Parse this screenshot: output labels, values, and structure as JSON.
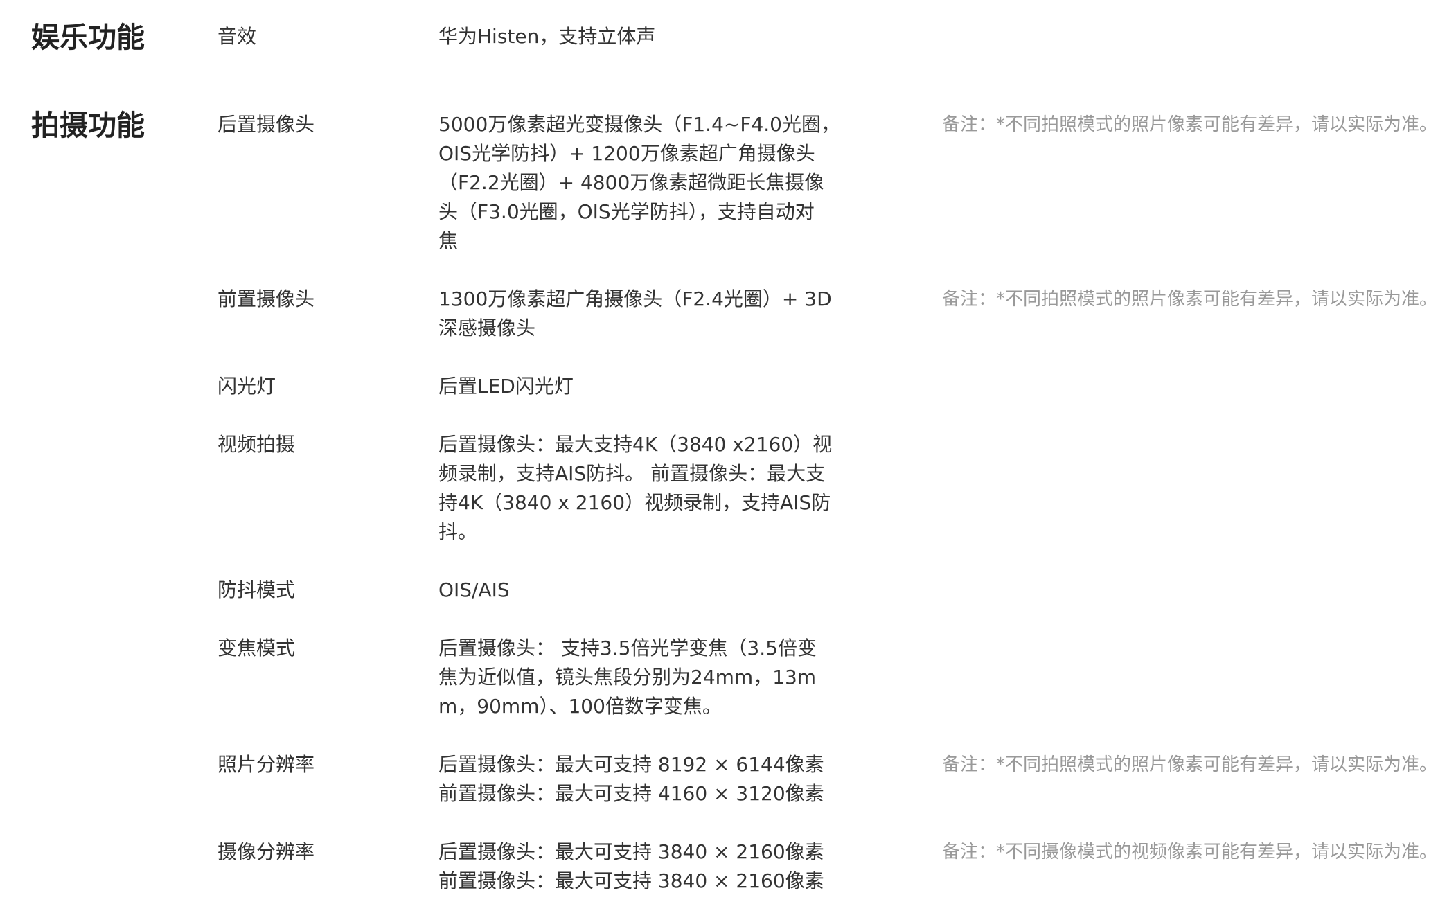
{
  "sections": [
    {
      "title": "娱乐功能",
      "rows": [
        {
          "label": "音效",
          "value_lines": [
            "华为Histen，支持立体声"
          ],
          "note": ""
        }
      ]
    },
    {
      "title": "拍摄功能",
      "rows": [
        {
          "label": "后置摄像头",
          "value_lines": [
            "5000万像素超光变摄像头（F1.4~F4.0光圈，",
            "OIS光学防抖）+ 1200万像素超广角摄像头",
            "（F2.2光圈）+ 4800万像素超微距长焦摄像",
            "头（F3.0光圈，OIS光学防抖），支持自动对",
            "焦"
          ],
          "note": "备注：*不同拍照模式的照片像素可能有差异，请以实际为准。"
        },
        {
          "label": "前置摄像头",
          "value_lines": [
            "1300万像素超广角摄像头（F2.4光圈）+ 3D",
            "深感摄像头"
          ],
          "note": "备注：*不同拍照模式的照片像素可能有差异，请以实际为准。"
        },
        {
          "label": "闪光灯",
          "value_lines": [
            "后置LED闪光灯"
          ],
          "note": ""
        },
        {
          "label": "视频拍摄",
          "value_lines": [
            "后置摄像头：最大支持4K（3840 x2160）视",
            "频录制，支持AIS防抖。 前置摄像头：最大支",
            "持4K（3840 x 2160）视频录制，支持AIS防",
            "抖。"
          ],
          "note": ""
        },
        {
          "label": "防抖模式",
          "value_lines": [
            "OIS/AIS"
          ],
          "note": ""
        },
        {
          "label": "变焦模式",
          "value_lines": [
            "后置摄像头： 支持3.5倍光学变焦（3.5倍变",
            "焦为近似值，镜头焦段分别为24mm，13m",
            "m，90mm）、100倍数字变焦。"
          ],
          "note": ""
        },
        {
          "label": "照片分辨率",
          "value_lines": [
            "后置摄像头：最大可支持 8192 × 6144像素",
            "前置摄像头：最大可支持 4160 × 3120像素"
          ],
          "note": "备注：*不同拍照模式的照片像素可能有差异，请以实际为准。"
        },
        {
          "label": "摄像分辨率",
          "value_lines": [
            "后置摄像头：最大可支持 3840 × 2160像素",
            "前置摄像头：最大可支持 3840 × 2160像素"
          ],
          "note": "备注：*不同摄像模式的视频像素可能有差异，请以实际为准。"
        }
      ]
    }
  ]
}
